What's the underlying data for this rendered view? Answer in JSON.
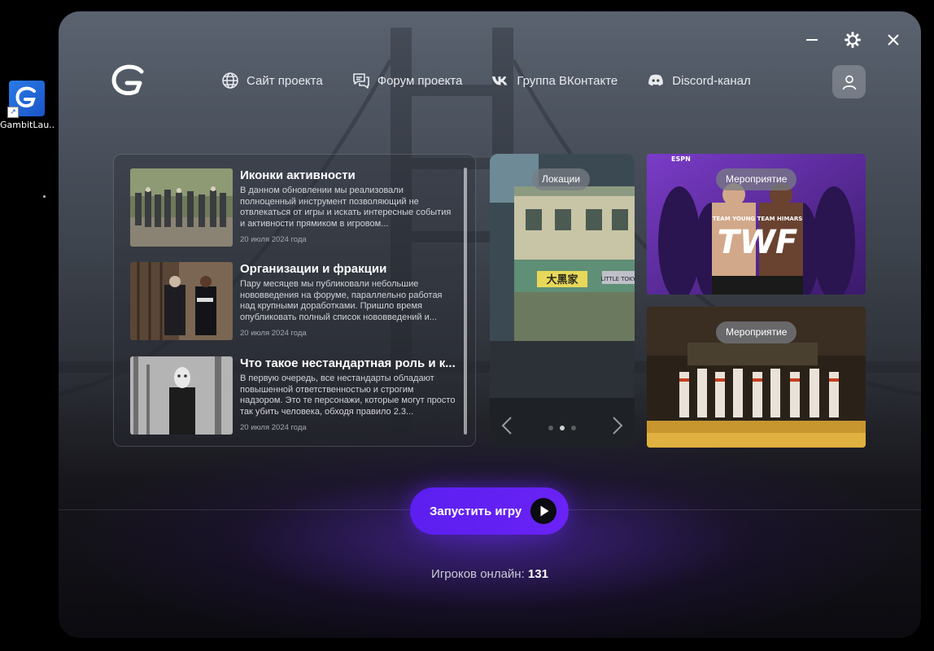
{
  "desktop": {
    "icon_label": "GambitLau..."
  },
  "launcher": {
    "nav": [
      {
        "label": "Сайт проекта",
        "icon": "globe-icon"
      },
      {
        "label": "Форум проекта",
        "icon": "forum-icon"
      },
      {
        "label": "Группа ВКонтакте",
        "icon": "vk-icon"
      },
      {
        "label": "Discord-канал",
        "icon": "discord-icon"
      }
    ],
    "news": [
      {
        "title": "Иконки активности",
        "description": "В данном обновлении мы реализовали полноценный инструмент позволяющий не отвлекаться от игры и искать интересные события и активности прямиком в игровом...",
        "date": "20 июля 2024 года"
      },
      {
        "title": "Организации и фракции",
        "description": "Пару месяцев мы публиковали небольшие нововведения на форуме, параллельно работая над крупными доработками. Пришло время опубликовать полный список нововведений и...",
        "date": "20 июля 2024 года"
      },
      {
        "title": "Что такое нестандартная роль и к...",
        "description": "В первую очередь, все нестандарты обладают повышенной ответственностью и строгим надзором. Это те персонажи, которые могут просто так убить человека, обходя правило 2.3...",
        "date": "20 июля 2024 года"
      }
    ],
    "carousel": {
      "tag": "Локации",
      "sign": "大黑家",
      "sign2": "LITTLE TOKY",
      "slide_count": 3,
      "active_slide": 2
    },
    "events": [
      {
        "tag": "Мероприятие",
        "logo": "TWF",
        "top_label": "ESPN",
        "sub_label": "TEAM YOUNG  TEAM HIMARS"
      },
      {
        "tag": "Мероприятие"
      }
    ],
    "play_button": "Запустить игру",
    "online": {
      "label": "Игроков онлайн:",
      "count": "131"
    },
    "colors": {
      "accent": "#5b1ff0",
      "background": "#2c2f36"
    }
  }
}
